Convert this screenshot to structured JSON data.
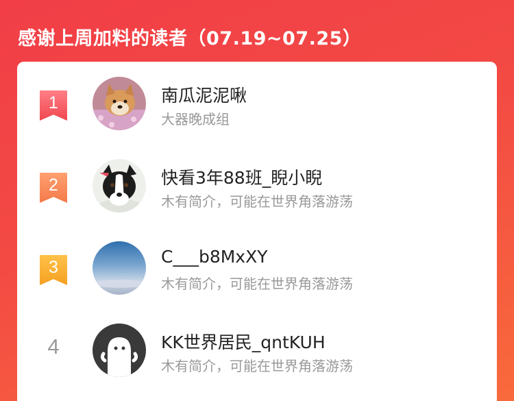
{
  "header": {
    "title": "感谢上周加料的读者（07.19~07.25）"
  },
  "readers": [
    {
      "rank": "1",
      "name": "南瓜泥泥啾",
      "bio": "大器晚成组",
      "avatar_icon": "shiba-dog-avatar"
    },
    {
      "rank": "2",
      "name": "快看3年88班_睨小睨",
      "bio": "木有简介，可能在世界角落游荡",
      "avatar_icon": "border-collie-avatar"
    },
    {
      "rank": "3",
      "name": "C___b8MxXY",
      "bio": "木有简介，可能在世界角落游荡",
      "avatar_icon": "sky-avatar"
    },
    {
      "rank": "4",
      "name": "KK世界居民_qntKUH",
      "bio": "木有简介，可能在世界角落游荡",
      "avatar_icon": "default-ghost-avatar"
    }
  ],
  "colors": {
    "header_bg": "#f13e47",
    "rank1": "#f0474f",
    "rank2": "#f47a4a",
    "rank3": "#f5a021",
    "name_text": "#222222",
    "bio_text": "#999999"
  }
}
